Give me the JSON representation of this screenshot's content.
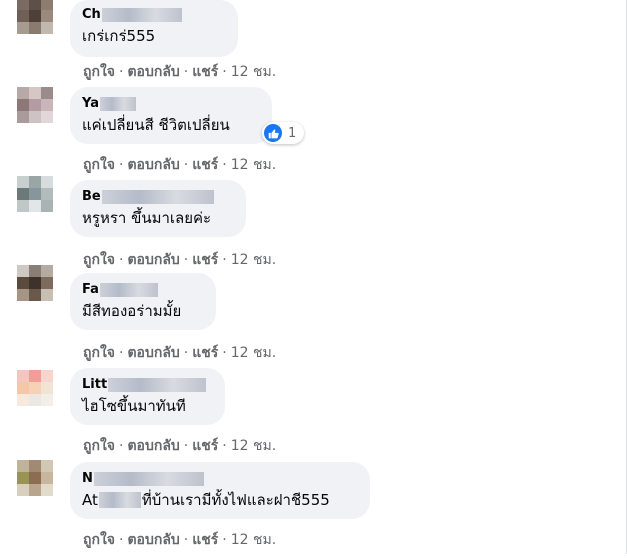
{
  "comments": [
    {
      "name_visible": "Ch",
      "text_before": "เกร่เกร่555",
      "text_after": "",
      "text_redacted": false,
      "avatar_colors": [
        "#7a6b62",
        "#5e4f48",
        "#8d7c70",
        "#6f5f55",
        "#4e4039",
        "#9a8a7d",
        "#a79a8e",
        "#8a7b6f",
        "#c2b8ad"
      ],
      "actions": {
        "like": "ถูกใจ",
        "reply": "ตอบกลับ",
        "share": "แชร์",
        "time": "12 ชม."
      },
      "reaction": null
    },
    {
      "name_visible": "Ya",
      "text_before": "แค่เปลี่ยนสี ชีวิตเปลี่ยน",
      "text_after": "",
      "text_redacted": false,
      "avatar_colors": [
        "#b8a9a8",
        "#d6c6c4",
        "#9c8b8c",
        "#8e7778",
        "#b49ca2",
        "#c9b6ba",
        "#a99a9b",
        "#cfc2c3",
        "#e1d7d8"
      ],
      "actions": {
        "like": "ถูกใจ",
        "reply": "ตอบกลับ",
        "share": "แชร์",
        "time": "12 ชม."
      },
      "reaction": {
        "count": "1",
        "icon": "like-icon"
      }
    },
    {
      "name_visible": "Be",
      "text_before": "หรูหรา ขึ้นมาเลยค่ะ",
      "text_after": "",
      "text_redacted": false,
      "avatar_colors": [
        "#c9cfcf",
        "#9aa5a6",
        "#d7dcdc",
        "#6c7979",
        "#87969a",
        "#b2bcbd",
        "#c0c7c7",
        "#e3e6e6",
        "#aab3b4"
      ],
      "actions": {
        "like": "ถูกใจ",
        "reply": "ตอบกลับ",
        "share": "แชร์",
        "time": "12 ชม."
      },
      "reaction": null
    },
    {
      "name_visible": "Fa",
      "text_before": "มีสีทองอร่ามมั้ย",
      "text_after": "",
      "text_redacted": false,
      "avatar_colors": [
        "#cfc9c3",
        "#8a7f74",
        "#b5aba1",
        "#5b4a3e",
        "#3f322a",
        "#7d6b5d",
        "#a59585",
        "#6a584b",
        "#c9beb2"
      ],
      "actions": {
        "like": "ถูกใจ",
        "reply": "ตอบกลับ",
        "share": "แชร์",
        "time": "12 ชม."
      },
      "reaction": null
    },
    {
      "name_visible": "Litt",
      "text_before": "ไฮโซขึ้นมาทันที",
      "text_after": "",
      "text_redacted": false,
      "avatar_colors": [
        "#f3c6c0",
        "#f19e98",
        "#f7d4cc",
        "#f4c7a8",
        "#f6d1b6",
        "#f1e4d2",
        "#f8e9dd",
        "#ece7e2",
        "#f4eee8"
      ],
      "actions": {
        "like": "ถูกใจ",
        "reply": "ตอบกลับ",
        "share": "แชร์",
        "time": "12 ชม."
      },
      "reaction": null
    },
    {
      "name_visible": "N",
      "text_before": "At",
      "text_after": "ที่บ้านเรามีทั้งไฟและฝาชี555",
      "text_redacted": true,
      "avatar_colors": [
        "#bfb49a",
        "#a08a73",
        "#d2c7b3",
        "#9a9356",
        "#8b6e52",
        "#c7b79e",
        "#d8cfbf",
        "#b7a58c",
        "#e2dacb"
      ],
      "actions": {
        "like": "ถูกใจ",
        "reply": "ตอบกลับ",
        "share": "แชร์",
        "time": "12 ชม."
      },
      "reaction": null
    }
  ]
}
